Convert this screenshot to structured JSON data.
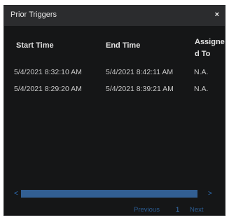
{
  "dialog": {
    "title": "Prior Triggers",
    "close_label": "×"
  },
  "table": {
    "columns": [
      "Start Time",
      "End Time",
      "Assigned To"
    ],
    "rows": [
      [
        "5/4/2021 8:32:10 AM",
        "5/4/2021 8:42:11 AM",
        "N.A."
      ],
      [
        "5/4/2021 8:29:20 AM",
        "5/4/2021 8:39:21 AM",
        "N.A."
      ]
    ]
  },
  "scrollbar": {
    "left_arrow": "<",
    "right_arrow": ">"
  },
  "pagination": {
    "previous": "Previous",
    "current_page": "1",
    "next": "Next"
  },
  "colors": {
    "background": "#151617",
    "titlebar": "#2b2c2e",
    "accent": "#325f93"
  }
}
